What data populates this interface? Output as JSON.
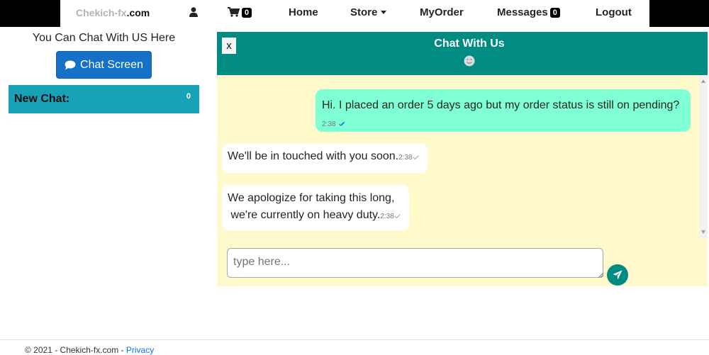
{
  "nav": {
    "brand_part1": "Chekich-fx",
    "brand_part2": ".com",
    "cart_count": "0",
    "home": "Home",
    "store": "Store",
    "myorder": "MyOrder",
    "messages": "Messages",
    "messages_count": "0",
    "logout": "Logout"
  },
  "left": {
    "title": "You Can Chat With US Here",
    "chat_button": "Chat Screen",
    "new_chat_label": "New Chat:",
    "new_chat_count": "0"
  },
  "chat": {
    "close_label": "x",
    "title": "Chat With Us",
    "messages": [
      {
        "text": "Hi. I placed an order 5 days ago but my order status is still on pending?",
        "time": "2:38",
        "direction": "outgoing",
        "status": "read"
      },
      {
        "text": "We'll be in touched with you soon.",
        "time": "2:38",
        "direction": "incoming",
        "status": "sent"
      },
      {
        "line1": "We apologize for taking this long,",
        "line2": " we're currently on heavy duty.",
        "time": "2:38",
        "direction": "incoming",
        "status": "sent"
      }
    ],
    "input_placeholder": "type here...",
    "send_icon": "paper-plane-icon"
  },
  "footer": {
    "copyright": "© 2021 - Chekich-fx.com - ",
    "privacy": "Privacy"
  },
  "colors": {
    "header": "#008c82",
    "chat_bg": "#fff9cc",
    "outgoing_bubble": "#7fffd4",
    "incoming_bubble": "#ffffff",
    "button": "#1570c8",
    "new_chat_bar": "#17a2b8"
  }
}
